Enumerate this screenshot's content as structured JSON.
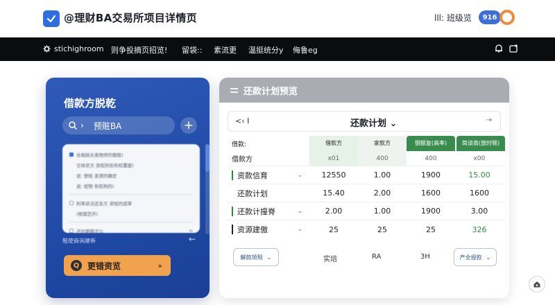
{
  "app": {
    "title": "@理财BA交易所项目详情页",
    "user_text": "lll: 班级览",
    "badge": "916"
  },
  "navbar": {
    "brand": "stichighroom",
    "items": [
      "则争投摘页招览!",
      "留袋::",
      "素流更",
      "温挺统分y",
      "侮鲁eg"
    ]
  },
  "left_panel": {
    "title": "借款方脱乾",
    "search_text": "预赃BA",
    "add_label": "+",
    "card_lines": [
      "合相统长奥物师的期限)",
      "交体货方 资权所形所权署建)",
      "说: 使程 发源的确定",
      "说: 程物 有权构的)",
      "利率状况还及方 资程的成率",
      "(核理范开)",
      "还时期期次公"
    ],
    "footer_text": "鞋使商询建新",
    "footer_arrow": "←",
    "button_icon": "Q",
    "button_label": "更错资览",
    "button_arrow": "»"
  },
  "right_panel": {
    "header": "还款计划预览",
    "prev": "<‹ I",
    "sub_title": "还款计划 ⌄",
    "next": "⇥",
    "columns": [
      "借款:",
      "借款方",
      "家款方",
      "钢额复(高率)",
      "简谈南(放时顿)"
    ],
    "subheader": [
      "借款方",
      "x01",
      "400",
      "400",
      "x00"
    ],
    "rows": [
      {
        "label": "资款信育",
        "bar": "#2e8b3e",
        "cells": [
          "12550",
          "1.00",
          "1900",
          "15.00"
        ],
        "last_green": true
      },
      {
        "label": "还款计划",
        "bar": "",
        "cells": [
          "15.40",
          "2.00",
          "1600",
          "1600"
        ],
        "last_green": false
      },
      {
        "label": "还款计撞脊",
        "bar": "#2e8b3e",
        "cells": [
          "2.00",
          "1.00",
          "1900",
          "3.00"
        ],
        "last_green": false
      },
      {
        "label": "资源建傲",
        "bar": "#1b1f29",
        "cells": [
          "25",
          "25",
          "25",
          "326"
        ],
        "last_green": true
      }
    ],
    "footer": {
      "left_select": "解款项规",
      "texts": [
        "实培",
        "RA",
        "3H"
      ],
      "right_select": "产全授款"
    }
  },
  "fab_icon": "home-settings-icon"
}
